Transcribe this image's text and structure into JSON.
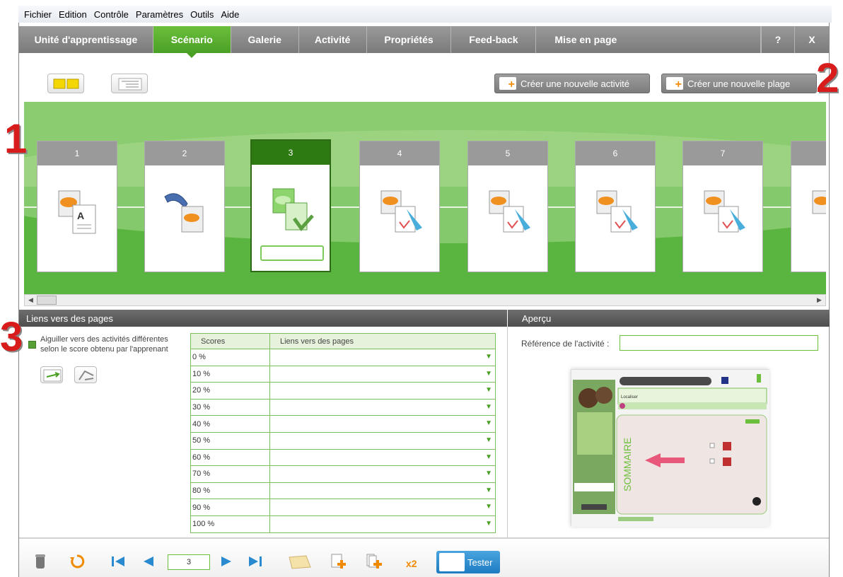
{
  "menu": {
    "items": [
      "Fichier",
      "Edition",
      "Contrôle",
      "Paramètres",
      "Outils",
      "Aide"
    ]
  },
  "tabs": [
    {
      "label": "Unité d'apprentissage",
      "active": false
    },
    {
      "label": "Scénario",
      "active": true
    },
    {
      "label": "Galerie",
      "active": false
    },
    {
      "label": "Activité",
      "active": false
    },
    {
      "label": "Propriétés",
      "active": false
    },
    {
      "label": "Feed-back",
      "active": false
    },
    {
      "label": "Mise en page",
      "active": false
    }
  ],
  "tab_help": "?",
  "tab_close": "X",
  "toolbar": {
    "new_activity": "Créer une nouvelle activité",
    "new_range": "Créer une nouvelle plage"
  },
  "cards": [
    {
      "num": "1",
      "icon": "text-page-icon",
      "active": false
    },
    {
      "num": "2",
      "icon": "video-page-icon",
      "active": false
    },
    {
      "num": "3",
      "icon": "exercise-page-icon",
      "active": true
    },
    {
      "num": "4",
      "icon": "exercise-page-icon",
      "active": false
    },
    {
      "num": "5",
      "icon": "exercise-page-icon",
      "active": false
    },
    {
      "num": "6",
      "icon": "exercise-page-icon",
      "active": false
    },
    {
      "num": "7",
      "icon": "exercise-page-icon",
      "active": false
    }
  ],
  "links_panel": {
    "title": "Liens vers des pages",
    "routing_label": "Aiguiller vers des activités différentes selon le score obtenu par l'apprenant",
    "col_scores": "Scores",
    "col_links": "Liens vers des pages",
    "rows": [
      "0 %",
      "10 %",
      "20 %",
      "30 %",
      "40 %",
      "50 %",
      "60 %",
      "70 %",
      "80 %",
      "90 %",
      "100 %"
    ]
  },
  "preview_panel": {
    "title": "Aperçu",
    "ref_label": "Référence de l'activité :",
    "ref_value": ""
  },
  "preview_thumb": {
    "heading": "Localiser",
    "side_text": "SOMMAIRE"
  },
  "bottombar": {
    "page": "3",
    "tester": "Tester"
  },
  "annotations": [
    "1",
    "2",
    "3"
  ],
  "colors": {
    "accent": "#4aa025",
    "timeline": "#5ab540",
    "tabbar": "#8a8a8a",
    "annotation": "#d81b1b",
    "tester": "#1d7bc0"
  }
}
